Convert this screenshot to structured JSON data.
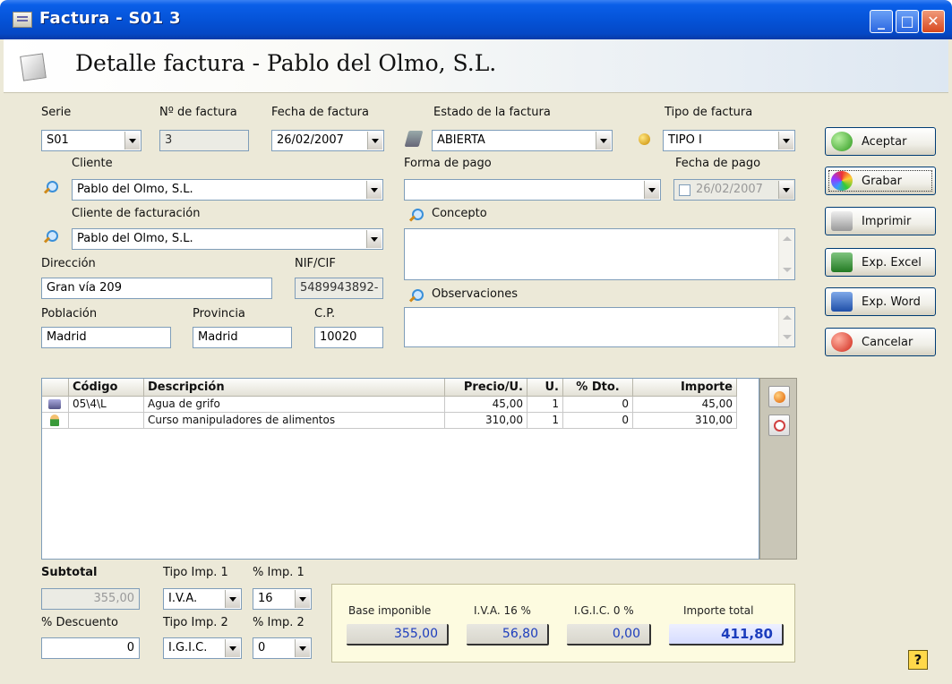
{
  "window": {
    "title": "Factura - S01 3",
    "header_title": "Detalle factura - Pablo del Olmo, S.L."
  },
  "form": {
    "serie": {
      "label": "Serie",
      "value": "S01"
    },
    "numero": {
      "label": "Nº de factura",
      "value": "3"
    },
    "fecha_factura": {
      "label": "Fecha de factura",
      "value": "26/02/2007"
    },
    "estado": {
      "label": "Estado de la factura",
      "value": "ABIERTA"
    },
    "tipo": {
      "label": "Tipo de factura",
      "value": "TIPO I"
    },
    "cliente": {
      "label": "Cliente",
      "value": "Pablo del Olmo, S.L."
    },
    "cliente_facturacion": {
      "label": "Cliente de facturación",
      "value": "Pablo del Olmo, S.L."
    },
    "forma_pago": {
      "label": "Forma de pago",
      "value": ""
    },
    "fecha_pago": {
      "label": "Fecha de pago",
      "value": "26/02/2007"
    },
    "concepto": {
      "label": "Concepto",
      "value": ""
    },
    "observaciones": {
      "label": "Observaciones",
      "value": ""
    },
    "direccion": {
      "label": "Dirección",
      "value": "Gran vía 209"
    },
    "nif": {
      "label": "NIF/CIF",
      "value": "5489943892-"
    },
    "poblacion": {
      "label": "Población",
      "value": "Madrid"
    },
    "provincia": {
      "label": "Provincia",
      "value": "Madrid"
    },
    "cp": {
      "label": "C.P.",
      "value": "10020"
    }
  },
  "actions": {
    "aceptar": "Aceptar",
    "grabar": "Grabar",
    "imprimir": "Imprimir",
    "exp_excel": "Exp. Excel",
    "exp_word": "Exp. Word",
    "cancelar": "Cancelar"
  },
  "lines": {
    "columns": [
      "Código",
      "Descripción",
      "Precio/U.",
      "U.",
      "% Dto.",
      "Importe"
    ],
    "rows": [
      {
        "codigo": "05\\4\\L",
        "descripcion": "Agua de grifo",
        "precio": "45,00",
        "unidades": "1",
        "dto": "0",
        "importe": "45,00",
        "icon": "product-icon"
      },
      {
        "codigo": "",
        "descripcion": "Curso manipuladores de alimentos",
        "precio": "310,00",
        "unidades": "1",
        "dto": "0",
        "importe": "310,00",
        "icon": "service-person-icon"
      }
    ]
  },
  "footer": {
    "subtotal": {
      "label": "Subtotal",
      "value": "355,00"
    },
    "descuento": {
      "label": "% Descuento",
      "value": "0"
    },
    "tipo_imp1": {
      "label": "Tipo Imp. 1",
      "value": "I.V.A."
    },
    "pct_imp1": {
      "label": "% Imp. 1",
      "value": "16"
    },
    "tipo_imp2": {
      "label": "Tipo Imp. 2",
      "value": "I.G.I.C."
    },
    "pct_imp2": {
      "label": "% Imp. 2",
      "value": "0"
    }
  },
  "totals": {
    "base": {
      "label": "Base imponible",
      "value": "355,00"
    },
    "iva": {
      "label": "I.V.A. 16 %",
      "value": "56,80"
    },
    "igic": {
      "label": "I.G.I.C. 0 %",
      "value": "0,00"
    },
    "total": {
      "label": "Importe total",
      "value": "411,80"
    }
  },
  "help_label": "?",
  "colors": {
    "titlebar": "#0553d8",
    "window_bg": "#ece9d8",
    "total_value": "#1c3dbd",
    "totals_bg": "#fdfbe0"
  }
}
